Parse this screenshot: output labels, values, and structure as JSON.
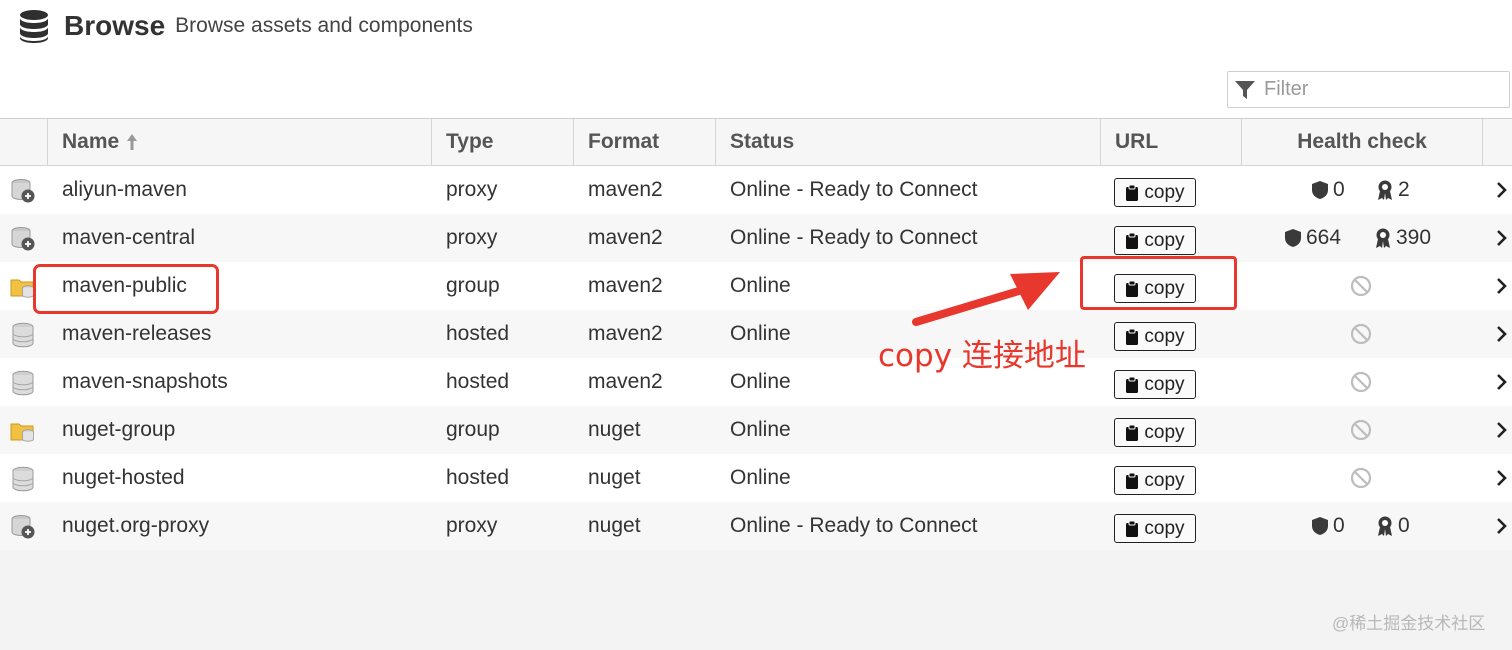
{
  "header": {
    "title": "Browse",
    "subtitle": "Browse assets and components",
    "icon": "database-icon"
  },
  "filter": {
    "placeholder": "Filter",
    "value": "",
    "icon": "funnel-icon"
  },
  "columns": {
    "name": "Name",
    "type": "Type",
    "format": "Format",
    "status": "Status",
    "url": "URL",
    "health": "Health check",
    "sort": "ascending"
  },
  "copy_label": "copy",
  "rows": [
    {
      "name": "aliyun-maven",
      "type": "proxy",
      "format": "maven2",
      "status": "Online - Ready to Connect",
      "icon": "proxy-repo-icon",
      "health": {
        "vulnerabilities": "0",
        "licenses": "2"
      }
    },
    {
      "name": "maven-central",
      "type": "proxy",
      "format": "maven2",
      "status": "Online - Ready to Connect",
      "icon": "proxy-repo-icon",
      "health": {
        "vulnerabilities": "664",
        "licenses": "390"
      }
    },
    {
      "name": "maven-public",
      "type": "group",
      "format": "maven2",
      "status": "Online",
      "icon": "group-repo-icon",
      "health": null
    },
    {
      "name": "maven-releases",
      "type": "hosted",
      "format": "maven2",
      "status": "Online",
      "icon": "hosted-repo-icon",
      "health": null
    },
    {
      "name": "maven-snapshots",
      "type": "hosted",
      "format": "maven2",
      "status": "Online",
      "icon": "hosted-repo-icon",
      "health": null
    },
    {
      "name": "nuget-group",
      "type": "group",
      "format": "nuget",
      "status": "Online",
      "icon": "group-repo-icon",
      "health": null
    },
    {
      "name": "nuget-hosted",
      "type": "hosted",
      "format": "nuget",
      "status": "Online",
      "icon": "hosted-repo-icon",
      "health": null
    },
    {
      "name": "nuget.org-proxy",
      "type": "proxy",
      "format": "nuget",
      "status": "Online - Ready to Connect",
      "icon": "proxy-repo-icon",
      "health": {
        "vulnerabilities": "0",
        "licenses": "0"
      }
    }
  ],
  "annotation": {
    "text": "copy 连接地址",
    "color": "#e8372c"
  },
  "watermark": "@稀土掘金技术社区"
}
